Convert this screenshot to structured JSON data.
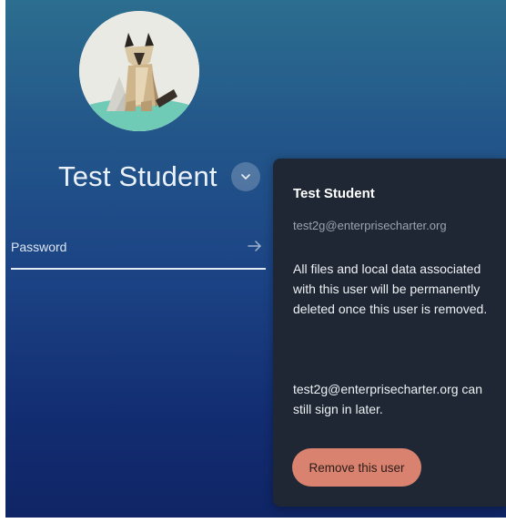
{
  "user": {
    "name": "Test Student",
    "avatar_icon": "origami-cat-avatar"
  },
  "password": {
    "placeholder": "Password",
    "value": "",
    "submit_icon": "arrow-right-icon"
  },
  "remove_card": {
    "name": "Test Student",
    "email": "test2g@enterprisecharter.org",
    "warning_text": "All files and local data associated with this user will be permanently deleted once this user is removed.",
    "signin_text": "test2g@enterprisecharter.org can still sign in later.",
    "remove_button_label": "Remove this user"
  },
  "colors": {
    "background_top": "#2c6e8f",
    "background_bottom": "#0f2565",
    "card_background": "#1e2733",
    "remove_button": "#d9826f"
  }
}
